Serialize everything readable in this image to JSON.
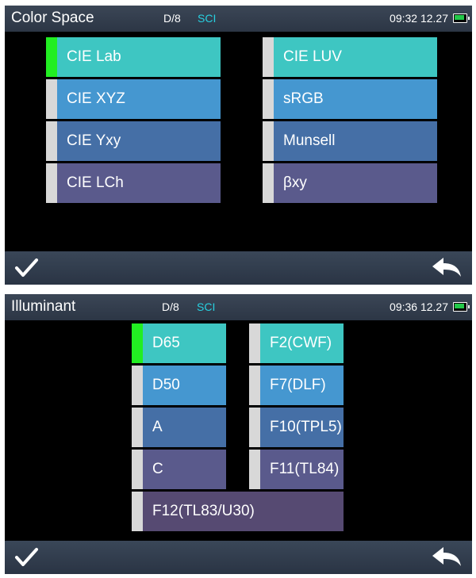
{
  "color_space_screen": {
    "title": "Color Space",
    "geometry": "D/8",
    "mode": "SCI",
    "clock": "09:32 12.27",
    "selected": "CIE Lab",
    "options": [
      "CIE Lab",
      "CIE XYZ",
      "CIE Yxy",
      "CIE LCh",
      "CIE LUV",
      "sRGB",
      "Munsell",
      "βxy"
    ]
  },
  "illuminant_screen": {
    "title": "Illuminant",
    "geometry": "D/8",
    "mode": "SCI",
    "clock": "09:36 12.27",
    "selected": "D65",
    "options": [
      "D65",
      "D50",
      "A",
      "C",
      "F2(CWF)",
      "F7(DLF)",
      "F10(TPL5)",
      "F11(TL84)",
      "F12(TL83/U30)"
    ]
  },
  "icons": {
    "confirm": "checkmark-icon",
    "back": "back-arrow-icon",
    "battery": "battery-charging-icon"
  },
  "colors": {
    "selected_marker": "#22ee22",
    "unselected_marker": "#d8d8d8",
    "mode_text": "#27d0e0",
    "battery_charge": "#23c84a"
  }
}
